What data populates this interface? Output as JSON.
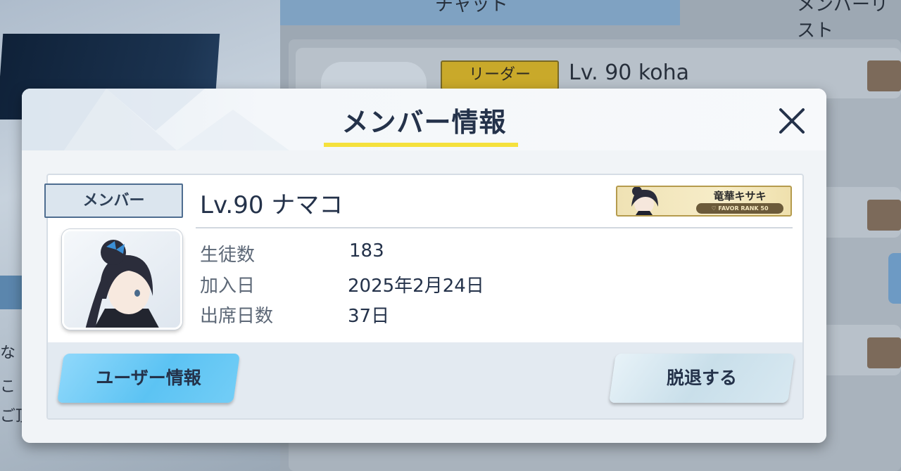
{
  "background": {
    "tabs": [
      "チャット",
      "メンバーリスト"
    ],
    "leader_badge": "リーダー",
    "leader_name": "Lv. 90 koha",
    "left_fragments": [
      "な",
      "こ",
      "ご頂"
    ]
  },
  "modal": {
    "title": "メンバー情報",
    "close_icon": "close-icon"
  },
  "member": {
    "role": "メンバー",
    "name": "Lv.90 ナマコ",
    "favorite": {
      "name": "竜華キサキ",
      "rank": "♡ FAVOR RANK 50"
    },
    "stats": [
      {
        "label": "生徒数",
        "value": "183"
      },
      {
        "label": "加入日",
        "value": "2025年2月24日"
      },
      {
        "label": "出席日数",
        "value": "37日"
      }
    ]
  },
  "buttons": {
    "user_info": "ユーザー情報",
    "leave": "脱退する"
  },
  "colors": {
    "accent_underline": "#f5e13d",
    "primary_button": "#5cc3f3",
    "title_text": "#24324a"
  }
}
